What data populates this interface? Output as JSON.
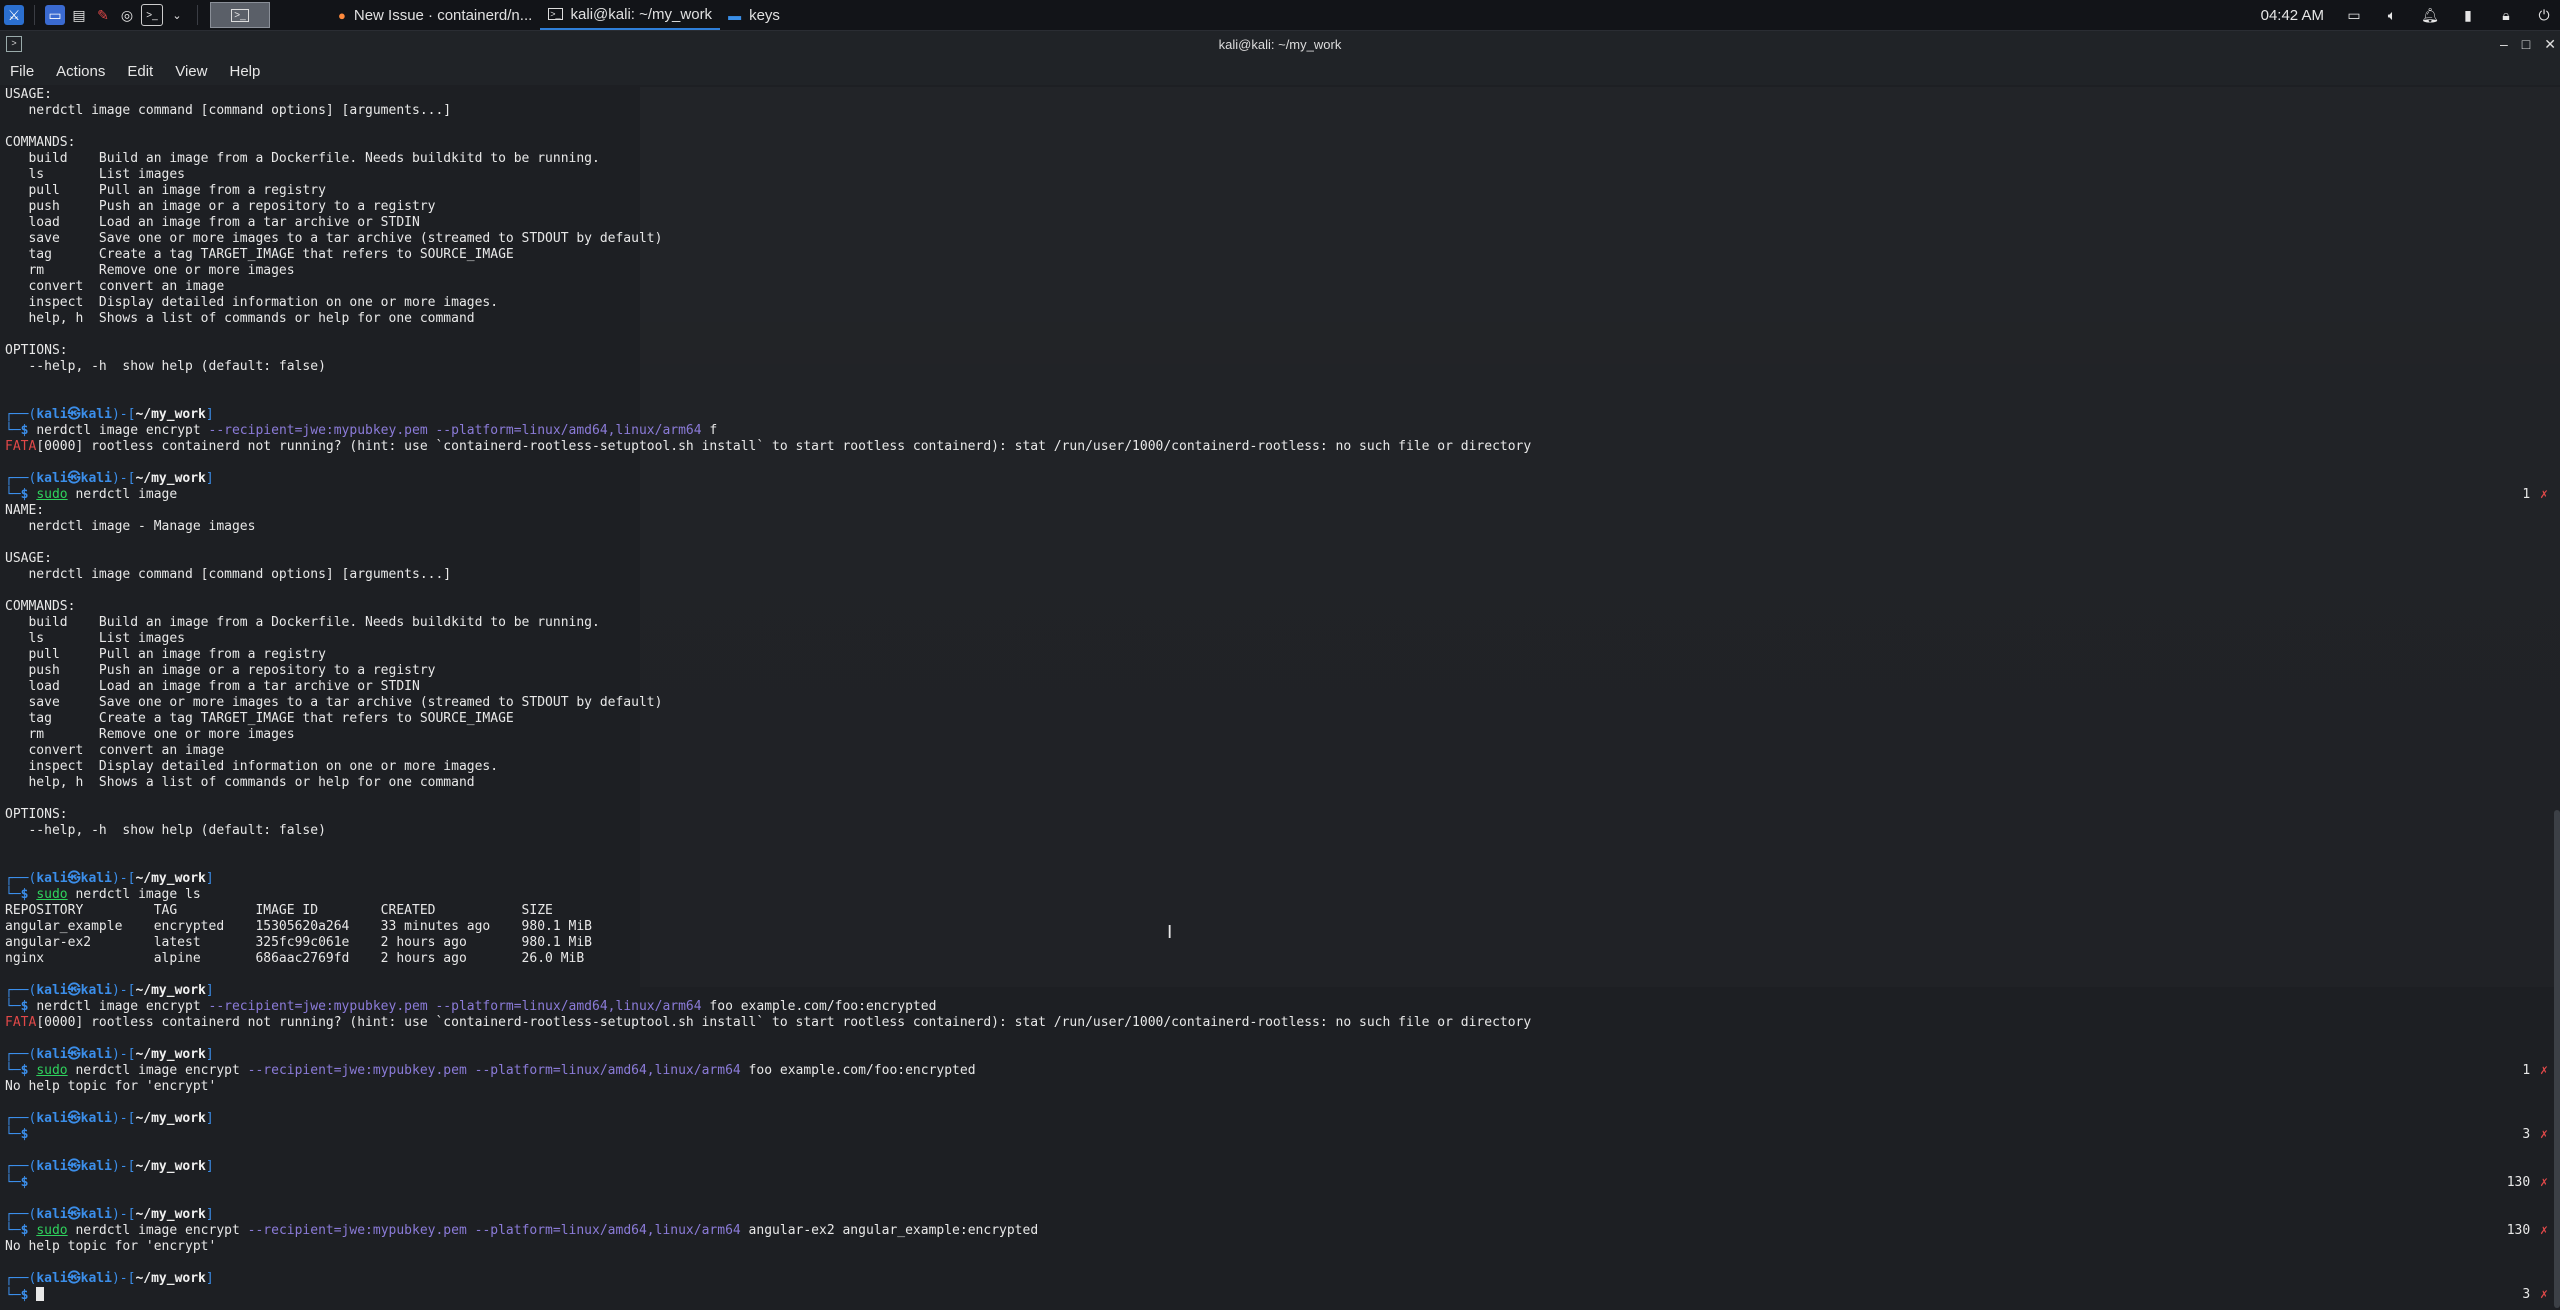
{
  "panel": {
    "quicklaunch": [
      "kali-menu-icon",
      "desktop-icon",
      "file-manager-icon",
      "text-editor-icon",
      "firefox-icon",
      "terminal-icon"
    ],
    "tasks": [
      {
        "icon": "firefox-icon",
        "label": "New Issue · containerd/n..."
      },
      {
        "icon": "terminal-icon",
        "label": "kali@kali: ~/my_work"
      },
      {
        "icon": "folder-icon",
        "label": "keys"
      }
    ],
    "clock": "04:42 AM"
  },
  "window": {
    "title": "kali@kali: ~/my_work",
    "menu": [
      "File",
      "Actions",
      "Edit",
      "View",
      "Help"
    ]
  },
  "terminal": {
    "lines": [
      {
        "t": "plain",
        "text": "USAGE:"
      },
      {
        "t": "plain",
        "text": "   nerdctl image command [command options] [arguments...]"
      },
      {
        "t": "plain",
        "text": ""
      },
      {
        "t": "plain",
        "text": "COMMANDS:"
      },
      {
        "t": "plain",
        "text": "   build    Build an image from a Dockerfile. Needs buildkitd to be running."
      },
      {
        "t": "plain",
        "text": "   ls       List images"
      },
      {
        "t": "plain",
        "text": "   pull     Pull an image from a registry"
      },
      {
        "t": "plain",
        "text": "   push     Push an image or a repository to a registry"
      },
      {
        "t": "plain",
        "text": "   load     Load an image from a tar archive or STDIN"
      },
      {
        "t": "plain",
        "text": "   save     Save one or more images to a tar archive (streamed to STDOUT by default)"
      },
      {
        "t": "plain",
        "text": "   tag      Create a tag TARGET_IMAGE that refers to SOURCE_IMAGE"
      },
      {
        "t": "plain",
        "text": "   rm       Remove one or more images"
      },
      {
        "t": "plain",
        "text": "   convert  convert an image"
      },
      {
        "t": "plain",
        "text": "   inspect  Display detailed information on one or more images."
      },
      {
        "t": "plain",
        "text": "   help, h  Shows a list of commands or help for one command"
      },
      {
        "t": "plain",
        "text": ""
      },
      {
        "t": "plain",
        "text": "OPTIONS:"
      },
      {
        "t": "plain",
        "text": "   --help, -h  show help (default: false)"
      },
      {
        "t": "plain",
        "text": ""
      },
      {
        "t": "plain",
        "text": ""
      },
      {
        "t": "prompt",
        "user": "kali",
        "host": "kali",
        "dir": "~/my_work"
      },
      {
        "t": "cmd",
        "sudo": "",
        "cmd": "nerdctl image encrypt ",
        "opts": "--recipient=jwe:mypubkey.pem --platform=linux/amd64,linux/arm64",
        "args": " f"
      },
      {
        "t": "fata",
        "tag": "FATA",
        "text": "[0000] rootless containerd not running? (hint: use `containerd-rootless-setuptool.sh install` to start rootless containerd): stat /run/user/1000/containerd-rootless: no such file or directory"
      },
      {
        "t": "plain",
        "text": ""
      },
      {
        "t": "prompt",
        "user": "kali",
        "host": "kali",
        "dir": "~/my_work"
      },
      {
        "t": "cmd",
        "sudo": "sudo",
        "cmd": " nerdctl image",
        "opts": "",
        "args": "",
        "rc": "1"
      },
      {
        "t": "plain",
        "text": "NAME:"
      },
      {
        "t": "plain",
        "text": "   nerdctl image - Manage images"
      },
      {
        "t": "plain",
        "text": ""
      },
      {
        "t": "plain",
        "text": "USAGE:"
      },
      {
        "t": "plain",
        "text": "   nerdctl image command [command options] [arguments...]"
      },
      {
        "t": "plain",
        "text": ""
      },
      {
        "t": "plain",
        "text": "COMMANDS:"
      },
      {
        "t": "plain",
        "text": "   build    Build an image from a Dockerfile. Needs buildkitd to be running."
      },
      {
        "t": "plain",
        "text": "   ls       List images"
      },
      {
        "t": "plain",
        "text": "   pull     Pull an image from a registry"
      },
      {
        "t": "plain",
        "text": "   push     Push an image or a repository to a registry"
      },
      {
        "t": "plain",
        "text": "   load     Load an image from a tar archive or STDIN"
      },
      {
        "t": "plain",
        "text": "   save     Save one or more images to a tar archive (streamed to STDOUT by default)"
      },
      {
        "t": "plain",
        "text": "   tag      Create a tag TARGET_IMAGE that refers to SOURCE_IMAGE"
      },
      {
        "t": "plain",
        "text": "   rm       Remove one or more images"
      },
      {
        "t": "plain",
        "text": "   convert  convert an image"
      },
      {
        "t": "plain",
        "text": "   inspect  Display detailed information on one or more images."
      },
      {
        "t": "plain",
        "text": "   help, h  Shows a list of commands or help for one command"
      },
      {
        "t": "plain",
        "text": ""
      },
      {
        "t": "plain",
        "text": "OPTIONS:"
      },
      {
        "t": "plain",
        "text": "   --help, -h  show help (default: false)"
      },
      {
        "t": "plain",
        "text": ""
      },
      {
        "t": "plain",
        "text": ""
      },
      {
        "t": "prompt",
        "user": "kali",
        "host": "kali",
        "dir": "~/my_work"
      },
      {
        "t": "cmd",
        "sudo": "sudo",
        "cmd": " nerdctl image ls",
        "opts": "",
        "args": ""
      },
      {
        "t": "plain",
        "text": "REPOSITORY         TAG          IMAGE ID        CREATED           SIZE"
      },
      {
        "t": "plain",
        "text": "angular_example    encrypted    15305620a264    33 minutes ago    980.1 MiB"
      },
      {
        "t": "plain",
        "text": "angular-ex2        latest       325fc99c061e    2 hours ago       980.1 MiB"
      },
      {
        "t": "plain",
        "text": "nginx              alpine       686aac2769fd    2 hours ago       26.0 MiB"
      },
      {
        "t": "plain",
        "text": ""
      },
      {
        "t": "prompt",
        "user": "kali",
        "host": "kali",
        "dir": "~/my_work"
      },
      {
        "t": "cmd",
        "sudo": "",
        "cmd": "nerdctl image encrypt ",
        "opts": "--recipient=jwe:mypubkey.pem --platform=linux/amd64,linux/arm64",
        "args": " foo example.com/foo:encrypted"
      },
      {
        "t": "fata",
        "tag": "FATA",
        "text": "[0000] rootless containerd not running? (hint: use `containerd-rootless-setuptool.sh install` to start rootless containerd): stat /run/user/1000/containerd-rootless: no such file or directory"
      },
      {
        "t": "plain",
        "text": ""
      },
      {
        "t": "prompt",
        "user": "kali",
        "host": "kali",
        "dir": "~/my_work"
      },
      {
        "t": "cmd",
        "sudo": "sudo",
        "cmd": " nerdctl image encrypt ",
        "opts": "--recipient=jwe:mypubkey.pem --platform=linux/amd64,linux/arm64",
        "args": " foo example.com/foo:encrypted",
        "rc": "1"
      },
      {
        "t": "plain",
        "text": "No help topic for 'encrypt'"
      },
      {
        "t": "plain",
        "text": ""
      },
      {
        "t": "prompt",
        "user": "kali",
        "host": "kali",
        "dir": "~/my_work"
      },
      {
        "t": "cmd",
        "sudo": "",
        "cmd": "",
        "opts": "",
        "args": "",
        "rc": "3"
      },
      {
        "t": "plain",
        "text": ""
      },
      {
        "t": "prompt",
        "user": "kali",
        "host": "kali",
        "dir": "~/my_work"
      },
      {
        "t": "cmd",
        "sudo": "",
        "cmd": "",
        "opts": "",
        "args": "",
        "rc": "130"
      },
      {
        "t": "plain",
        "text": ""
      },
      {
        "t": "prompt",
        "user": "kali",
        "host": "kali",
        "dir": "~/my_work"
      },
      {
        "t": "cmd",
        "sudo": "sudo",
        "cmd": " nerdctl image encrypt ",
        "opts": "--recipient=jwe:mypubkey.pem --platform=linux/amd64,linux/arm64",
        "args": " angular-ex2 angular_example:encrypted",
        "rc": "130"
      },
      {
        "t": "plain",
        "text": "No help topic for 'encrypt'"
      },
      {
        "t": "plain",
        "text": ""
      },
      {
        "t": "prompt",
        "user": "kali",
        "host": "kali",
        "dir": "~/my_work"
      },
      {
        "t": "cmd",
        "sudo": "",
        "cmd": "",
        "opts": "",
        "args": "",
        "rc": "3",
        "cursor": true
      }
    ]
  },
  "colors": {
    "prompt": "#3b8eea",
    "error": "#e04848",
    "sudo": "#2fd35d",
    "options": "#8b7bd8"
  }
}
